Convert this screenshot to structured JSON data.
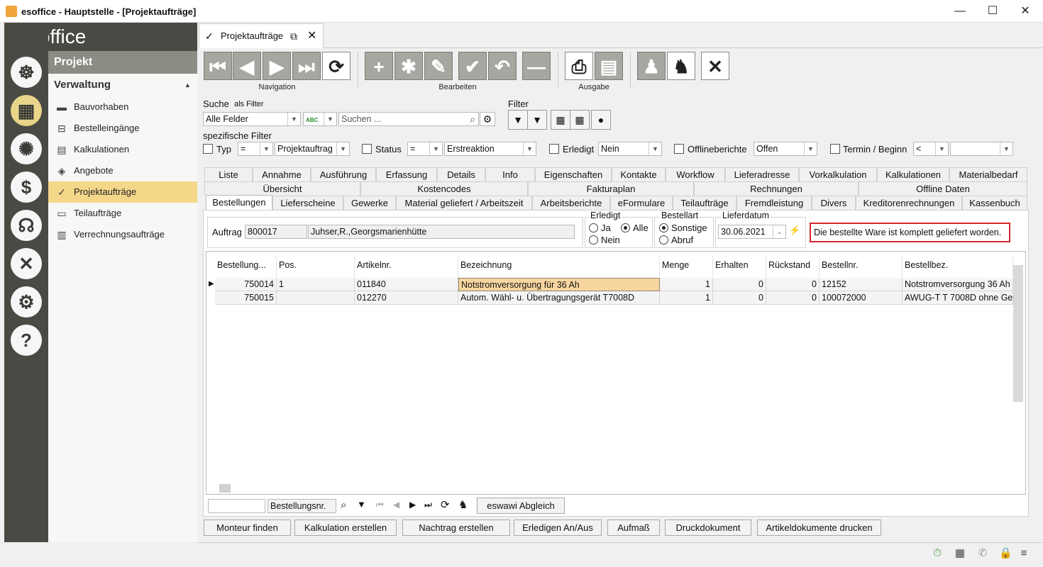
{
  "window": {
    "title": "esoffice - Hauptstelle - [Projektaufträge]",
    "minimize": "—",
    "maximize": "☐",
    "close": "✕"
  },
  "logo": {
    "chev": "›",
    "text": "esoffice"
  },
  "rail": {
    "items": [
      {
        "icon": "steering-wheel-icon",
        "glyph": "☸"
      },
      {
        "icon": "blueprint-icon",
        "glyph": "▦"
      },
      {
        "icon": "alarm-light-icon",
        "glyph": "✺"
      },
      {
        "icon": "money-icon",
        "glyph": "$"
      },
      {
        "icon": "headset-icon",
        "glyph": "☊"
      },
      {
        "icon": "tools-icon",
        "glyph": "✕"
      },
      {
        "icon": "gears-icon",
        "glyph": "⚙"
      },
      {
        "icon": "help-icon",
        "glyph": "?"
      }
    ]
  },
  "nav": {
    "header": "Projekt",
    "section": "Verwaltung",
    "section_chevron": "▲",
    "items": [
      {
        "label": "Bauvorhaben",
        "glyph": "▬"
      },
      {
        "label": "Bestelleingänge",
        "glyph": "⊟"
      },
      {
        "label": "Kalkulationen",
        "glyph": "▤"
      },
      {
        "label": "Angebote",
        "glyph": "◈"
      },
      {
        "label": "Projektaufträge",
        "glyph": "✓"
      },
      {
        "label": "Teilaufträge",
        "glyph": "▭"
      },
      {
        "label": "Verrechnungsaufträge",
        "glyph": "▥"
      }
    ]
  },
  "doc_tab": {
    "label": "Projektaufträge",
    "check": "✓",
    "popout": "⧉",
    "close": "✕"
  },
  "toolbar": {
    "navigation_label": "Navigation",
    "edit_label": "Bearbeiten",
    "output_label": "Ausgabe",
    "buttons": {
      "first": "⏮",
      "prev": "◀",
      "next": "▶",
      "last": "⏭",
      "refresh": "⟳",
      "add": "+",
      "multi": "✱",
      "edit": "✎",
      "save": "✔",
      "undo": "↶",
      "remove": "—",
      "print": "⎙",
      "export": "▤",
      "run1": "♟",
      "run2": "♞",
      "cancel": "✕"
    }
  },
  "search": {
    "label": "Suche",
    "as_filter": "als Filter",
    "field_select": "Alle Felder",
    "abc": "ABC",
    "placeholder": "Suchen ...",
    "magnifier": "⌕",
    "gear": "⚙"
  },
  "filter": {
    "label": "Filter",
    "specific_label": "spezifische Filter",
    "typ_label": "Typ",
    "typ_op": "=",
    "typ_value": "Projektauftrag",
    "status_label": "Status",
    "status_op": "=",
    "status_value": "Erstreaktion",
    "erledigt_label": "Erledigt",
    "erledigt_value": "Nein",
    "offline_label": "Offlineberichte",
    "offline_value": "Offen",
    "termin_label": "Termin / Beginn",
    "termin_op": "<",
    "termin_value": ""
  },
  "tabs": {
    "row1": [
      "Liste",
      "Annahme",
      "Ausführung",
      "Erfassung",
      "Details",
      "Info",
      "Eigenschaften",
      "Kontakte",
      "Workflow",
      "Lieferadresse",
      "Vorkalkulation",
      "Kalkulationen",
      "Materialbedarf"
    ],
    "row2": [
      "Übersicht",
      "Kostencodes",
      "Fakturaplan",
      "Rechnungen",
      "Offline Daten"
    ],
    "row3": [
      "Bestellungen",
      "Lieferscheine",
      "Gewerke",
      "Material geliefert / Arbeitszeit",
      "Arbeitsberichte",
      "eFormulare",
      "Teilaufträge",
      "Fremdleistung",
      "Divers",
      "Kreditorenrechnungen",
      "Kassenbuch"
    ]
  },
  "order": {
    "auftrag_label": "Auftrag",
    "auftrag_no": "800017",
    "auftrag_name": "Juhser,R.,Georgsmarienhütte",
    "erledigt_title": "Erledigt",
    "opt_ja": "Ja",
    "opt_alle": "Alle",
    "opt_nein": "Nein",
    "bestellart_title": "Bestellart",
    "opt_sonstige": "Sonstige",
    "opt_abruf": "Abruf",
    "lieferdatum_title": "Lieferdatum",
    "lieferdatum": "30.06.2021",
    "message": "Die bestellte Ware ist komplett geliefert worden."
  },
  "grid": {
    "columns": [
      "Bestellung...",
      "Pos.",
      "Artikelnr.",
      "Bezeichnung",
      "Menge",
      "Erhalten",
      "Rückstand",
      "Bestellnr.",
      "Bestellbez."
    ],
    "rows": [
      {
        "bestellung": "750014",
        "pos": "1",
        "artikel": "011840",
        "bezeichnung": "Notstromversorgung für 36 Ah",
        "menge": "1",
        "erhalten": "0",
        "rueckstand": "0",
        "bestellnr": "12152",
        "bestellbez": "Notstromversorgung 36 Ah"
      },
      {
        "bestellung": "750015",
        "pos": "",
        "artikel": "012270",
        "bezeichnung": "Autom. Wähl- u. Übertragungsgerät T7008D",
        "menge": "1",
        "erhalten": "0",
        "rueckstand": "0",
        "bestellnr": "100072000",
        "bestellbez": "AWUG-T T 7008D ohne Ge"
      }
    ]
  },
  "gridbar": {
    "search_value": "",
    "field": "Bestellungsnr.",
    "eswawi": "eswawi Abgleich"
  },
  "actions": [
    "Monteur finden",
    "Kalkulation erstellen",
    "Nachtrag erstellen",
    "Erledigen An/Aus",
    "Aufmaß",
    "Druckdokument",
    "Artikeldokumente drucken"
  ]
}
